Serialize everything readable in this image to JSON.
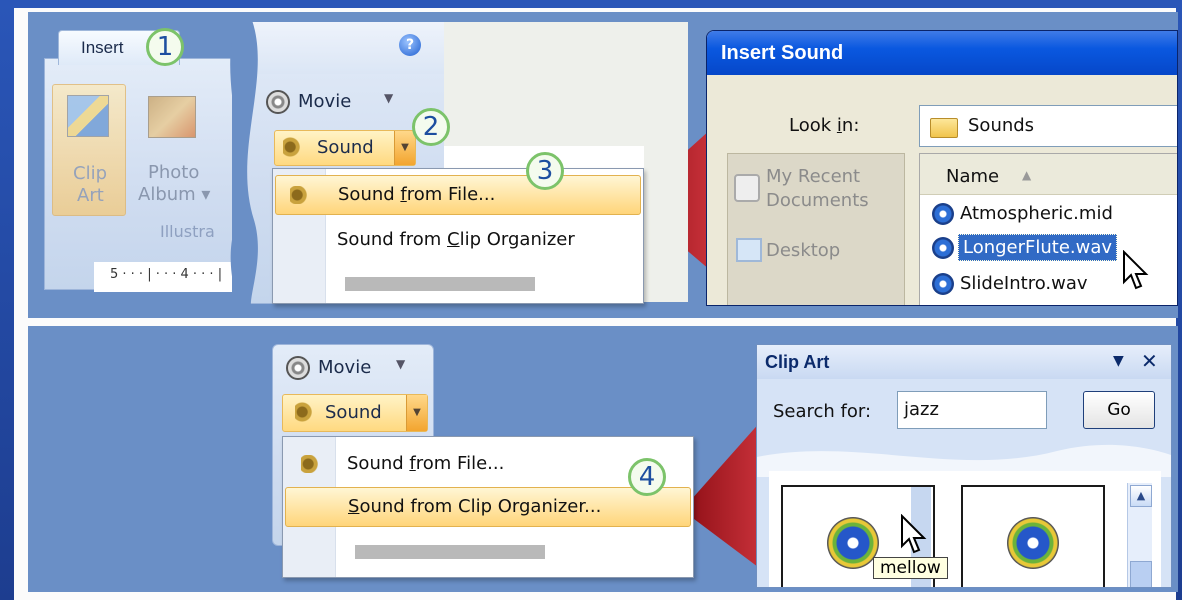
{
  "top": {
    "insert_tab": "Insert",
    "callouts": [
      "1",
      "2",
      "3",
      "4"
    ],
    "illustrations": {
      "clip_art": [
        "Clip",
        "Art"
      ],
      "photo_album": [
        "Photo",
        "Album ▾"
      ],
      "group_label": "Illustra"
    },
    "ruler_text": "5 · · · | · · · 4 · · · |",
    "movie_label": "Movie",
    "sound_label": "Sound",
    "menu": {
      "item1_pre": "Sound ",
      "item1_key": "f",
      "item1_post": "rom File...",
      "item2_pre": "Sound from ",
      "item2_key": "C",
      "item2_post": "lip Organizer"
    },
    "dialog": {
      "title": "Insert Sound",
      "look_in_pre": "Look ",
      "look_in_key": "i",
      "look_in_post": "n:",
      "look_in_value": "Sounds",
      "places": [
        "My Recent",
        "Documents",
        "Desktop"
      ],
      "column_name": "Name",
      "files": [
        "Atmospheric.mid",
        "LongerFlute.wav",
        "SlideIntro.wav"
      ]
    }
  },
  "bottom": {
    "movie_label": "Movie",
    "sound_label": "Sound",
    "menu": {
      "item1_pre": "Sound ",
      "item1_key": "f",
      "item1_post": "rom File...",
      "item2_pre": "",
      "item2_key": "S",
      "item2_post": "ound from Clip Organizer..."
    },
    "clip_art": {
      "title": "Clip Art",
      "search_label": "Search for:",
      "search_value": "jazz",
      "go_label": "Go",
      "tooltip": "mellow"
    }
  },
  "colors": {
    "frame": "#1d3d8f",
    "panel": "#6a8fc6",
    "highlight": "#ffd57a",
    "callout_ring": "#7cc36a",
    "dialog_title": "#0a58e0"
  }
}
